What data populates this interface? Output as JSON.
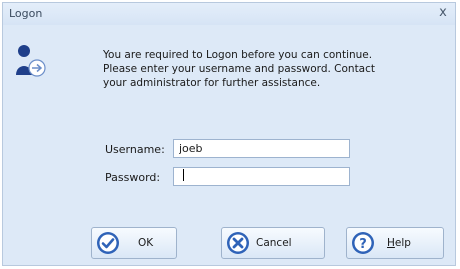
{
  "dialog": {
    "title": "Logon",
    "close_glyph": "x"
  },
  "message": {
    "lines": [
      "You are required to Logon before you can continue.",
      "Please enter your username and password. Contact",
      "your administrator for further assistance."
    ]
  },
  "form": {
    "username_label": "Username:",
    "username_value": "joeb",
    "password_label": "Password:",
    "password_value": ""
  },
  "buttons": {
    "ok": {
      "label": "OK",
      "icon": "check-icon"
    },
    "cancel": {
      "label": "Cancel",
      "icon": "cancel-icon"
    },
    "help": {
      "label_mnemonic": "H",
      "label_rest": "elp",
      "icon": "question-icon"
    }
  },
  "colors": {
    "accent": "#2f63b8",
    "background": "#dde9f7"
  }
}
